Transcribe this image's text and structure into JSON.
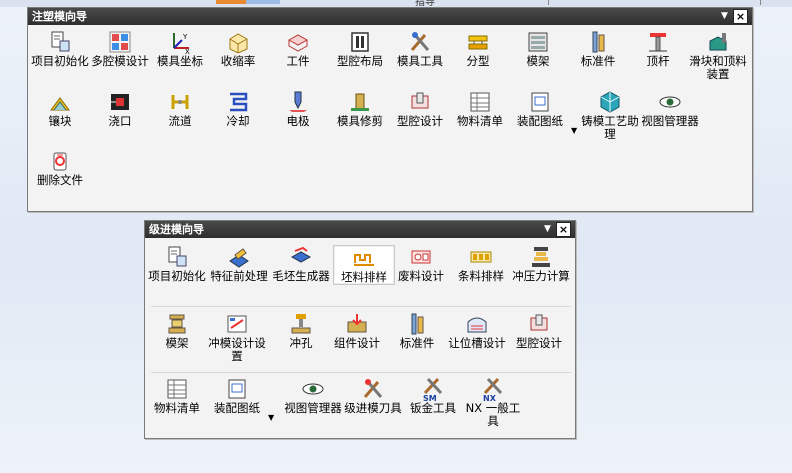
{
  "top_strip": {
    "cut_text": "指导"
  },
  "panel1": {
    "title": "注塑模向导",
    "tools": [
      {
        "id": "p1-project-init",
        "label": "项目初始化",
        "icon": "project-init-icon"
      },
      {
        "id": "p1-multi-cavity",
        "label": "多腔模设计",
        "icon": "multi-cavity-icon"
      },
      {
        "id": "p1-mold-csys",
        "label": "模具坐标",
        "icon": "mold-csys-icon"
      },
      {
        "id": "p1-shrinkage",
        "label": "收缩率",
        "icon": "shrinkage-icon"
      },
      {
        "id": "p1-workpiece",
        "label": "工件",
        "icon": "workpiece-icon"
      },
      {
        "id": "p1-cavity-layout",
        "label": "型腔布局",
        "icon": "cavity-layout-icon"
      },
      {
        "id": "p1-mold-tools",
        "label": "模具工具",
        "icon": "mold-tools-icon"
      },
      {
        "id": "p1-parting",
        "label": "分型",
        "icon": "parting-icon"
      },
      {
        "id": "p1-moldbase",
        "label": "模架",
        "icon": "moldbase-icon"
      },
      {
        "id": "p1-standard-part",
        "label": "标准件",
        "icon": "standard-part-icon"
      },
      {
        "id": "p1-ejector",
        "label": "顶杆",
        "icon": "ejector-pin-icon"
      },
      {
        "id": "p1-slider-lifter",
        "label": "滑块和顶料装置",
        "icon": "slider-lifter-icon"
      },
      {
        "id": "p1-insert",
        "label": "镶块",
        "icon": "insert-icon"
      },
      {
        "id": "p1-gate",
        "label": "浇口",
        "icon": "gate-icon"
      },
      {
        "id": "p1-runner",
        "label": "流道",
        "icon": "runner-icon"
      },
      {
        "id": "p1-cooling",
        "label": "冷却",
        "icon": "cooling-icon"
      },
      {
        "id": "p1-electrode",
        "label": "电极",
        "icon": "electrode-icon"
      },
      {
        "id": "p1-mold-trim",
        "label": "模具修剪",
        "icon": "mold-trim-icon"
      },
      {
        "id": "p1-pocket",
        "label": "型腔设计",
        "icon": "pocket-icon"
      },
      {
        "id": "p1-bom",
        "label": "物料清单",
        "icon": "bom-icon"
      },
      {
        "id": "p1-assembly-drawing",
        "label": "装配图纸",
        "icon": "assembly-drawing-icon"
      },
      {
        "id": "p1-casting-process",
        "label": "铸模工艺助理",
        "icon": "casting-process-icon"
      },
      {
        "id": "p1-view-manager",
        "label": "视图管理器",
        "icon": "view-manager-icon"
      },
      {
        "id": "p1-delete-files",
        "label": "删除文件",
        "icon": "delete-files-icon"
      }
    ]
  },
  "panel2": {
    "title": "级进模向导",
    "tools": [
      {
        "id": "p2-project-init",
        "label": "项目初始化",
        "icon": "project-init-icon"
      },
      {
        "id": "p2-feature-preprocess",
        "label": "特征前处理",
        "icon": "feature-preprocess-icon"
      },
      {
        "id": "p2-blank-generate",
        "label": "毛坯生成器",
        "icon": "blank-generator-icon"
      },
      {
        "id": "p2-blank-layout",
        "label": "坯料排样",
        "icon": "blank-layout-icon"
      },
      {
        "id": "p2-scrap-design",
        "label": "废料设计",
        "icon": "scrap-design-icon"
      },
      {
        "id": "p2-strip-layout",
        "label": "条料排样",
        "icon": "strip-layout-icon"
      },
      {
        "id": "p2-press-force",
        "label": "冲压力计算",
        "icon": "press-force-icon"
      },
      {
        "id": "p2-diebase",
        "label": "模架",
        "icon": "diebase-icon"
      },
      {
        "id": "p2-die-design",
        "label": "冲模设计设置",
        "icon": "die-design-icon"
      },
      {
        "id": "p2-piercing",
        "label": "冲孔",
        "icon": "piercing-icon"
      },
      {
        "id": "p2-component",
        "label": "组件设计",
        "icon": "component-design-icon"
      },
      {
        "id": "p2-standard-part",
        "label": "标准件",
        "icon": "standard-part-icon"
      },
      {
        "id": "p2-relief",
        "label": "让位槽设计",
        "icon": "relief-slot-icon"
      },
      {
        "id": "p2-pocket",
        "label": "型腔设计",
        "icon": "pocket-icon"
      },
      {
        "id": "p2-bom",
        "label": "物料清单",
        "icon": "bom-icon"
      },
      {
        "id": "p2-assembly-drawing",
        "label": "装配图纸",
        "icon": "assembly-drawing-icon"
      },
      {
        "id": "p2-view-manager",
        "label": "视图管理器",
        "icon": "view-manager-icon"
      },
      {
        "id": "p2-pdw-tools",
        "label": "级进模刀具",
        "icon": "pdw-tools-icon"
      },
      {
        "id": "p2-sheetmetal",
        "label": "钣金工具",
        "icon": "sheetmetal-tools-icon"
      },
      {
        "id": "p2-nx-general",
        "label": "NX 一般工具",
        "icon": "nx-general-tools-icon"
      }
    ]
  }
}
